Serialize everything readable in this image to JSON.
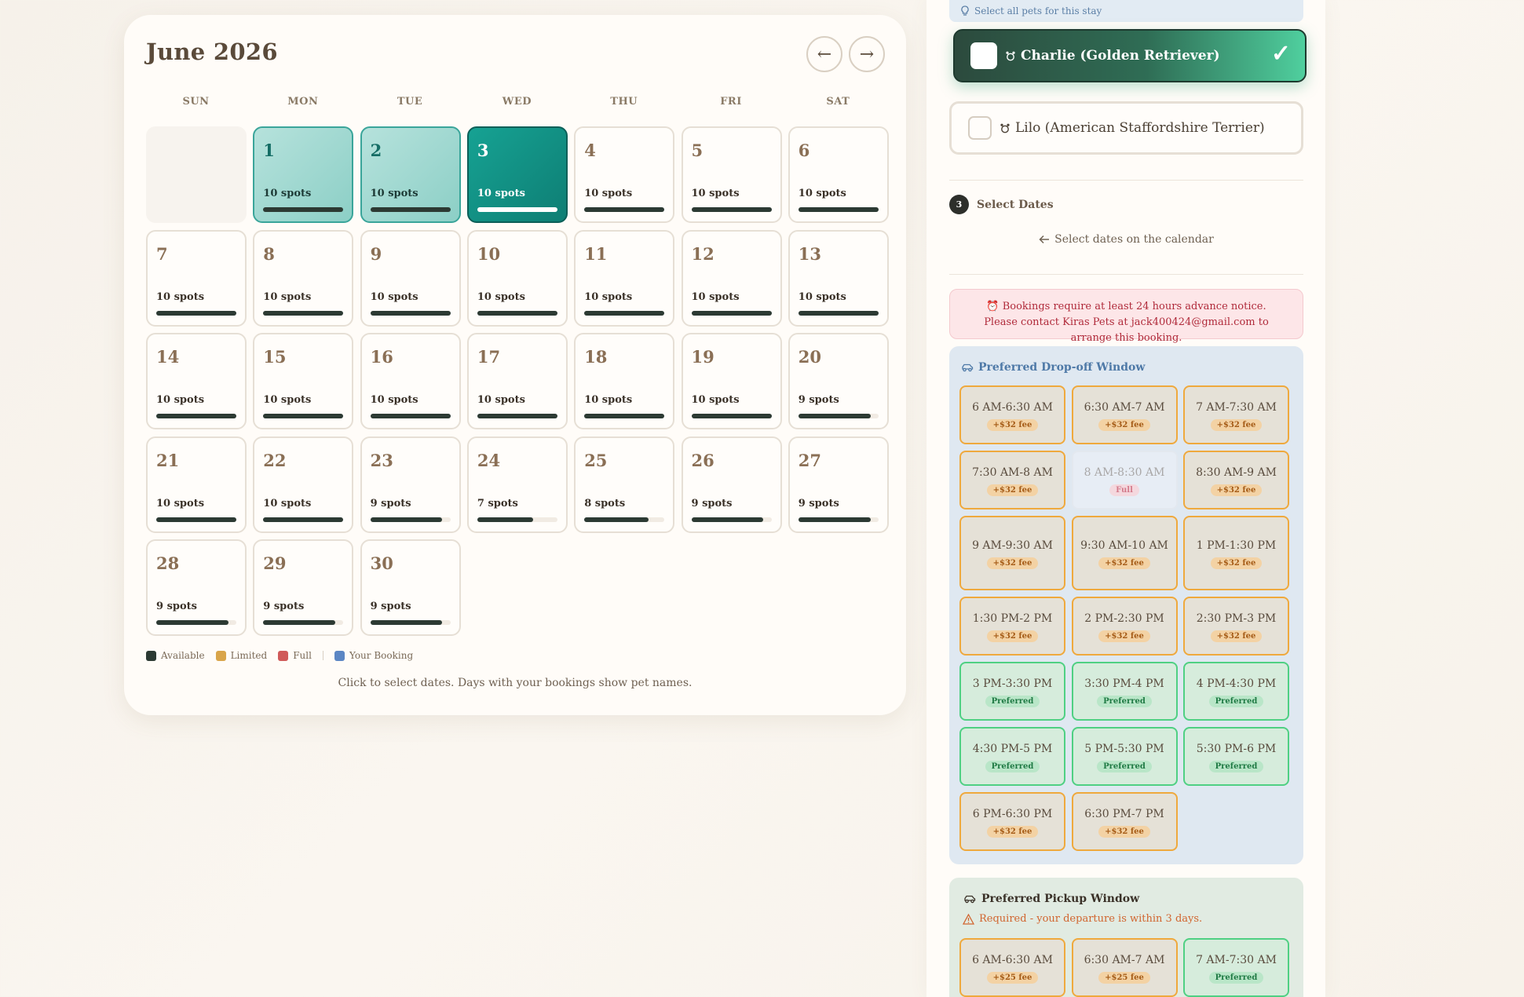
{
  "calendar": {
    "title": "June 2026",
    "nav_prev": "←",
    "nav_next": "→",
    "weekdays": [
      "SUN",
      "MON",
      "TUE",
      "WED",
      "THU",
      "FRI",
      "SAT"
    ],
    "first_weekday_offset": 1,
    "max_spots": 10,
    "days": [
      {
        "day": "1",
        "spots": "10 spots",
        "count": 10,
        "state": "selected-range"
      },
      {
        "day": "2",
        "spots": "10 spots",
        "count": 10,
        "state": "selected-range"
      },
      {
        "day": "3",
        "spots": "10 spots",
        "count": 10,
        "state": "selected"
      },
      {
        "day": "4",
        "spots": "10 spots",
        "count": 10,
        "state": "available"
      },
      {
        "day": "5",
        "spots": "10 spots",
        "count": 10,
        "state": "available"
      },
      {
        "day": "6",
        "spots": "10 spots",
        "count": 10,
        "state": "available"
      },
      {
        "day": "7",
        "spots": "10 spots",
        "count": 10,
        "state": "available"
      },
      {
        "day": "8",
        "spots": "10 spots",
        "count": 10,
        "state": "available"
      },
      {
        "day": "9",
        "spots": "10 spots",
        "count": 10,
        "state": "available"
      },
      {
        "day": "10",
        "spots": "10 spots",
        "count": 10,
        "state": "available"
      },
      {
        "day": "11",
        "spots": "10 spots",
        "count": 10,
        "state": "available"
      },
      {
        "day": "12",
        "spots": "10 spots",
        "count": 10,
        "state": "available"
      },
      {
        "day": "13",
        "spots": "10 spots",
        "count": 10,
        "state": "available"
      },
      {
        "day": "14",
        "spots": "10 spots",
        "count": 10,
        "state": "available"
      },
      {
        "day": "15",
        "spots": "10 spots",
        "count": 10,
        "state": "available"
      },
      {
        "day": "16",
        "spots": "10 spots",
        "count": 10,
        "state": "available"
      },
      {
        "day": "17",
        "spots": "10 spots",
        "count": 10,
        "state": "available"
      },
      {
        "day": "18",
        "spots": "10 spots",
        "count": 10,
        "state": "available"
      },
      {
        "day": "19",
        "spots": "10 spots",
        "count": 10,
        "state": "available"
      },
      {
        "day": "20",
        "spots": "9 spots",
        "count": 9,
        "state": "available"
      },
      {
        "day": "21",
        "spots": "10 spots",
        "count": 10,
        "state": "available"
      },
      {
        "day": "22",
        "spots": "10 spots",
        "count": 10,
        "state": "available"
      },
      {
        "day": "23",
        "spots": "9 spots",
        "count": 9,
        "state": "available"
      },
      {
        "day": "24",
        "spots": "7 spots",
        "count": 7,
        "state": "available"
      },
      {
        "day": "25",
        "spots": "8 spots",
        "count": 8,
        "state": "available"
      },
      {
        "day": "26",
        "spots": "9 spots",
        "count": 9,
        "state": "available"
      },
      {
        "day": "27",
        "spots": "9 spots",
        "count": 9,
        "state": "available"
      },
      {
        "day": "28",
        "spots": "9 spots",
        "count": 9,
        "state": "available"
      },
      {
        "day": "29",
        "spots": "9 spots",
        "count": 9,
        "state": "available"
      },
      {
        "day": "30",
        "spots": "9 spots",
        "count": 9,
        "state": "available"
      }
    ],
    "legend": [
      {
        "label": "Available",
        "color": "#2c3a33"
      },
      {
        "label": "Limited",
        "color": "#d9a54a"
      },
      {
        "label": "Full",
        "color": "#d05a5a"
      },
      {
        "label": "Your Booking",
        "color": "#5b86c4"
      }
    ],
    "hint": "Click to select dates. Days with your bookings show pet names."
  },
  "panel": {
    "pets_hint": "Select all pets for this stay",
    "pets": [
      {
        "name": "Charlie (Golden Retriever)",
        "selected": true,
        "icon": "paw-icon"
      },
      {
        "name": "Lilo (American Staffordshire Terrier)",
        "selected": false,
        "icon": "paw-icon"
      }
    ],
    "pet_check_mark": "✓",
    "step": {
      "number": "3",
      "label": "Select Dates"
    },
    "select_dates_hint": "Select dates on the calendar",
    "notice": "⏰ Bookings require at least 24 hours advance notice. Please contact Kiras Pets at jack400424@gmail.com to arrange this booking.",
    "dropoff": {
      "title": "Preferred Drop-off Window",
      "slots": [
        {
          "time": "6 AM-6:30 AM",
          "tag": "+$32 fee",
          "kind": "fee"
        },
        {
          "time": "6:30 AM-7 AM",
          "tag": "+$32 fee",
          "kind": "fee"
        },
        {
          "time": "7 AM-7:30 AM",
          "tag": "+$32 fee",
          "kind": "fee"
        },
        {
          "time": "7:30 AM-8 AM",
          "tag": "+$32 fee",
          "kind": "fee"
        },
        {
          "time": "8 AM-8:30 AM",
          "tag": "Full",
          "kind": "full"
        },
        {
          "time": "8:30 AM-9 AM",
          "tag": "+$32 fee",
          "kind": "fee"
        },
        {
          "time": "9 AM-9:30 AM",
          "tag": "+$32 fee",
          "kind": "fee"
        },
        {
          "time": "9:30 AM-10 AM",
          "tag": "+$32 fee",
          "kind": "fee"
        },
        {
          "time": "1 PM-1:30 PM",
          "tag": "+$32 fee",
          "kind": "fee"
        },
        {
          "time": "1:30 PM-2 PM",
          "tag": "+$32 fee",
          "kind": "fee"
        },
        {
          "time": "2 PM-2:30 PM",
          "tag": "+$32 fee",
          "kind": "fee"
        },
        {
          "time": "2:30 PM-3 PM",
          "tag": "+$32 fee",
          "kind": "fee"
        },
        {
          "time": "3 PM-3:30 PM",
          "tag": "Preferred",
          "kind": "pref"
        },
        {
          "time": "3:30 PM-4 PM",
          "tag": "Preferred",
          "kind": "pref"
        },
        {
          "time": "4 PM-4:30 PM",
          "tag": "Preferred",
          "kind": "pref"
        },
        {
          "time": "4:30 PM-5 PM",
          "tag": "Preferred",
          "kind": "pref"
        },
        {
          "time": "5 PM-5:30 PM",
          "tag": "Preferred",
          "kind": "pref"
        },
        {
          "time": "5:30 PM-6 PM",
          "tag": "Preferred",
          "kind": "pref"
        },
        {
          "time": "6 PM-6:30 PM",
          "tag": "+$32 fee",
          "kind": "fee"
        },
        {
          "time": "6:30 PM-7 PM",
          "tag": "+$32 fee",
          "kind": "fee"
        }
      ]
    },
    "pickup": {
      "title": "Preferred Pickup Window",
      "subtitle": "Required - your departure is within 3 days.",
      "slots": [
        {
          "time": "6 AM-6:30 AM",
          "tag": "+$25 fee",
          "kind": "fee"
        },
        {
          "time": "6:30 AM-7 AM",
          "tag": "+$25 fee",
          "kind": "fee"
        },
        {
          "time": "7 AM-7:30 AM",
          "tag": "Preferred",
          "kind": "pref"
        }
      ]
    },
    "colors": {
      "accent_teal": "#0e7e74",
      "fee_border": "#efa93d",
      "preferred_border": "#4fd083",
      "notice_text": "#b02a3a",
      "dropoff_title": "#4e79a7"
    }
  }
}
